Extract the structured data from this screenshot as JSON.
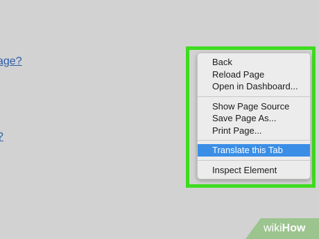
{
  "page": {
    "links": [
      "age?",
      "?"
    ]
  },
  "context_menu": {
    "groups": [
      [
        "Back",
        "Reload Page",
        "Open in Dashboard..."
      ],
      [
        "Show Page Source",
        "Save Page As...",
        "Print Page..."
      ],
      [
        "Translate this Tab"
      ],
      [
        "Inspect Element"
      ]
    ],
    "selected": "Translate this Tab"
  },
  "watermark": {
    "wiki": "wiki",
    "how": "How"
  },
  "colors": {
    "background": "#d2d2d2",
    "highlight_border": "#3ddc1e",
    "menu_background": "#ececec",
    "selection": "#3a8ee6",
    "link": "#2a5ca8",
    "watermark": "#9bc48e"
  }
}
